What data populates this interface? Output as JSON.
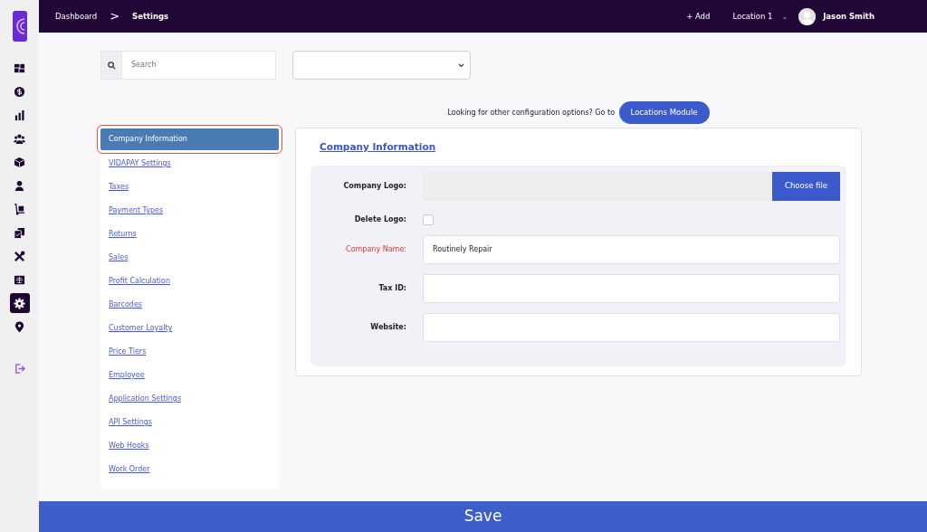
{
  "topbar": {
    "breadcrumbs": [
      {
        "label": "Dashboard"
      },
      {
        "label": "Settings"
      }
    ],
    "separator": ">",
    "add": "+ Add",
    "location": "Location 1",
    "location_caret": "⌄",
    "user": "Jason Smith"
  },
  "rail": {
    "items": [
      {
        "selected": false
      },
      {
        "selected": false
      },
      {
        "selected": false
      },
      {
        "selected": false
      },
      {
        "selected": false
      },
      {
        "selected": false
      },
      {
        "selected": false
      },
      {
        "selected": false
      },
      {
        "selected": false
      },
      {
        "selected": false
      },
      {
        "selected": true
      },
      {
        "selected": false
      }
    ]
  },
  "search": {
    "placeholder": "Search"
  },
  "notice": {
    "text": "Looking for other configuration options? Go to",
    "button": "Locations Module"
  },
  "menu": {
    "items": [
      {
        "label": "Company Information",
        "selected": true
      },
      {
        "label": "VIDAPAY Settings",
        "selected": false
      },
      {
        "label": "Taxes",
        "selected": false
      },
      {
        "label": "Payment Types",
        "selected": false
      },
      {
        "label": "Returns",
        "selected": false
      },
      {
        "label": "Sales",
        "selected": false
      },
      {
        "label": "Profit Calculation",
        "selected": false
      },
      {
        "label": "Barcodes",
        "selected": false
      },
      {
        "label": "Customer Loyalty",
        "selected": false
      },
      {
        "label": "Price Tiers",
        "selected": false
      },
      {
        "label": "Employee",
        "selected": false
      },
      {
        "label": "Application Settings",
        "selected": false
      },
      {
        "label": "API Settings",
        "selected": false
      },
      {
        "label": "Web Hooks",
        "selected": false
      },
      {
        "label": "Work Order",
        "selected": false
      }
    ]
  },
  "form": {
    "title": "Company Information",
    "fields": [
      {
        "kind": "file",
        "label": "Company Logo:",
        "required": false,
        "button": "Choose file"
      },
      {
        "kind": "checkbox",
        "label": "Delete Logo:",
        "required": false,
        "checked": false
      },
      {
        "kind": "text",
        "label": "Company Name:",
        "required": true,
        "value": "Routinely Repair"
      },
      {
        "kind": "text",
        "label": "Tax ID:",
        "required": false
      },
      {
        "kind": "text",
        "label": "Website:",
        "required": false
      }
    ]
  },
  "save": "Save"
}
